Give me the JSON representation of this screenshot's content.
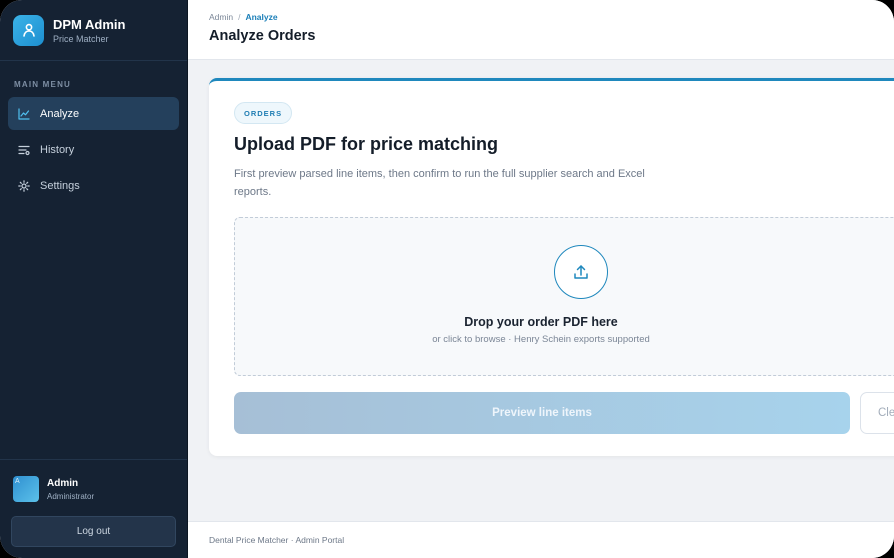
{
  "brand": {
    "title": "DPM Admin",
    "subtitle": "Price Matcher",
    "logo_icon": "user-icon",
    "accent": "#2aa4de"
  },
  "sidebar": {
    "menu_label": "MAIN MENU",
    "items": [
      {
        "label": "Analyze",
        "icon": "chart-line-icon",
        "active": true
      },
      {
        "label": "History",
        "icon": "list-icon",
        "active": false
      },
      {
        "label": "Settings",
        "icon": "gear-icon",
        "active": false
      }
    ]
  },
  "user": {
    "avatar_text": "A",
    "name": "Admin",
    "role": "Administrator",
    "logout_label": "Log out"
  },
  "header": {
    "breadcrumb": {
      "root": "Admin",
      "separator": "/",
      "current": "Analyze"
    },
    "title": "Analyze Orders"
  },
  "card": {
    "badge": "ORDERS",
    "title": "Upload PDF for price matching",
    "description": "First preview parsed line items, then confirm to run the full supplier search and Excel reports.",
    "dropzone": {
      "icon": "upload-icon",
      "title": "Drop your order PDF here",
      "subtitle": "or click to browse · Henry Schein exports supported"
    },
    "preview_button": "Preview line items",
    "clear_button": "Cle"
  },
  "footer": {
    "text": "Dental Price Matcher · Admin Portal"
  },
  "colors": {
    "sidebar_bg": "#152233",
    "primary": "#1f88bd",
    "active_nav": "#24405c"
  }
}
